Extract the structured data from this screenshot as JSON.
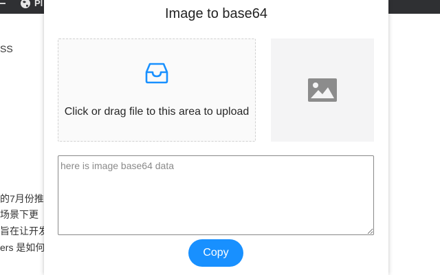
{
  "background": {
    "topbar_text": "Pl",
    "side_text": "SS",
    "lines": [
      "的7月份推",
      "场景下更",
      "旨在让开发",
      "ers 是如何"
    ]
  },
  "popup": {
    "title": "Image to base64",
    "dropzone": {
      "icon": "inbox-icon",
      "text": "Click or drag file to this area to upload"
    },
    "preview": {
      "icon": "image-icon"
    },
    "textarea": {
      "placeholder": "here is image base64 data",
      "value": ""
    },
    "copy_label": "Copy"
  },
  "colors": {
    "accent": "#1890ff",
    "topbar": "#2f3033"
  }
}
